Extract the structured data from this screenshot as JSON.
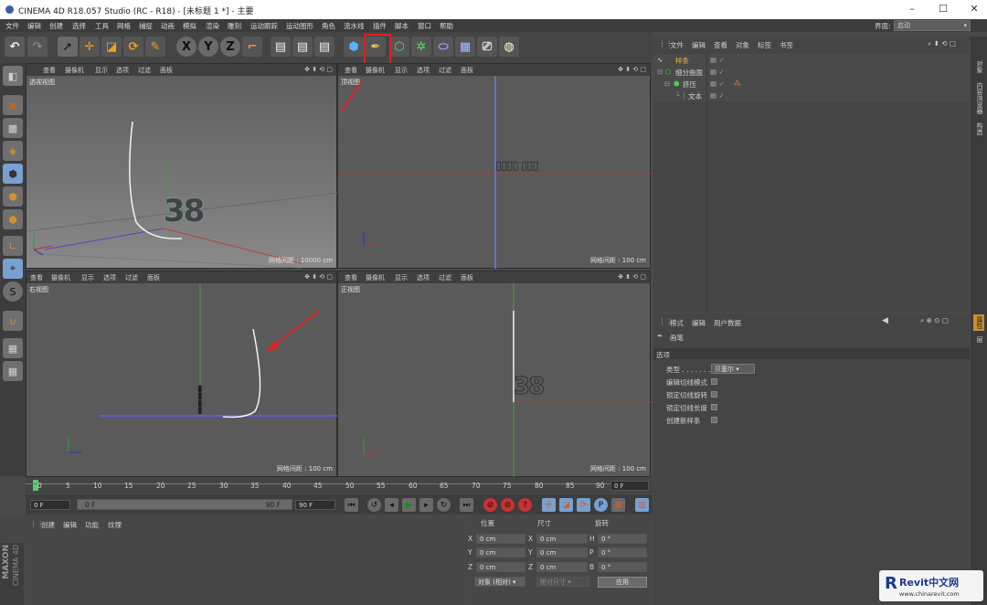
{
  "window": {
    "title": "CINEMA 4D R18.057 Studio (RC - R18) - [未标题 1 *] - 主要"
  },
  "menu": [
    "文件",
    "编辑",
    "创建",
    "选择",
    "工具",
    "网格",
    "捕捉",
    "动画",
    "模拟",
    "渲染",
    "雕刻",
    "运动跟踪",
    "运动图形",
    "角色",
    "流水线",
    "插件",
    "脚本",
    "窗口",
    "帮助"
  ],
  "layout": {
    "label": "界面:",
    "value": "启动"
  },
  "viewport_menu": [
    "查看",
    "摄像机",
    "显示",
    "选项",
    "过滤",
    "面板"
  ],
  "viewports": {
    "persp": {
      "name": "透视视图",
      "grid": "网格间距 : 10000 cm"
    },
    "top": {
      "name": "顶视图",
      "grid": "网格间距 : 100 cm"
    },
    "right": {
      "name": "右视图",
      "grid": "网格间距 : 100 cm"
    },
    "front": {
      "name": "正视图",
      "grid": "网格间距 : 100 cm"
    }
  },
  "viewport_text": "38",
  "timeline": {
    "ticks": [
      "0",
      "5",
      "10",
      "15",
      "20",
      "25",
      "30",
      "35",
      "40",
      "45",
      "50",
      "55",
      "60",
      "65",
      "70",
      "75",
      "80",
      "85",
      "90"
    ],
    "current": "0 F"
  },
  "transport": {
    "start": "0 F",
    "slider_left": "0 F",
    "slider_right": "90 F",
    "end": "90 F"
  },
  "material": {
    "menu": [
      "创建",
      "编辑",
      "功能",
      "纹理"
    ]
  },
  "coords": {
    "headers": [
      "位置",
      "尺寸",
      "旋转"
    ],
    "rows": [
      {
        "a": "X",
        "pos": "0 cm",
        "b": "X",
        "size": "0 cm",
        "c": "H",
        "rot": "0 °"
      },
      {
        "a": "Y",
        "pos": "0 cm",
        "b": "Y",
        "size": "0 cm",
        "c": "P",
        "rot": "0 °"
      },
      {
        "a": "Z",
        "pos": "0 cm",
        "b": "Z",
        "size": "0 cm",
        "c": "B",
        "rot": "0 °"
      }
    ],
    "mode": "对象 (相对)",
    "size_mode": "绝对尺寸",
    "apply": "应用"
  },
  "object_manager": {
    "menu": [
      "文件",
      "编辑",
      "查看",
      "对象",
      "标签",
      "书签"
    ],
    "items": [
      "样条",
      "细分曲面",
      "挤压",
      "文本"
    ]
  },
  "attributes": {
    "menu": [
      "模式",
      "编辑",
      "用户数据"
    ],
    "tool_name": "画笔",
    "section": "选项",
    "type_label": "类型 . . . . . . . .",
    "type_value": "贝塞尔",
    "options": [
      "编辑切线模式",
      "锁定切线旋转",
      "锁定切线长度",
      "创建新样条"
    ]
  },
  "right_tabs": [
    "对象",
    "内容浏览器",
    "构造"
  ],
  "right_tabs_lower": [
    "属性",
    "层"
  ],
  "brand": {
    "maxon": "MAXON",
    "c4d": "CINEMA 4D"
  },
  "watermark": {
    "title": "Revit中文网",
    "url": "www.chinarevit.com"
  }
}
